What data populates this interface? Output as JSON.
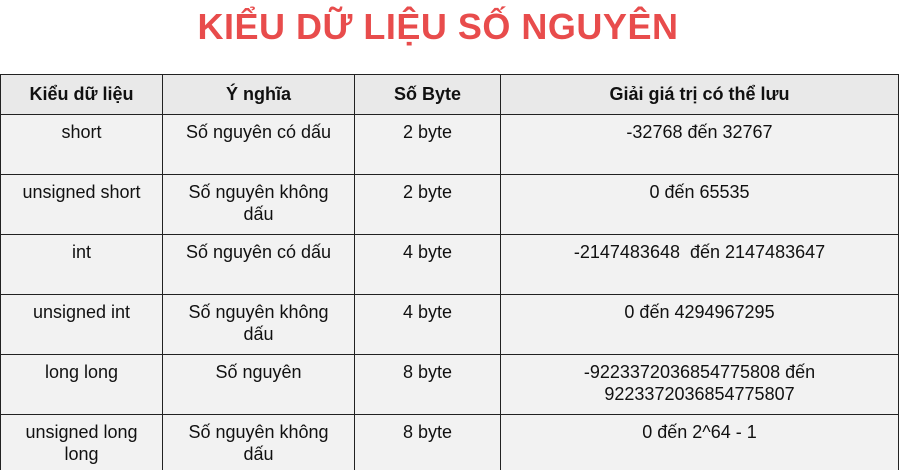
{
  "title": "KIỂU DỮ LIỆU SỐ NGUYÊN",
  "table": {
    "headers": [
      "Kiểu dữ liệu",
      "Ý nghĩa",
      "Số Byte",
      "Giải giá trị có thể lưu"
    ],
    "rows": [
      [
        "short",
        "Số nguyên có dấu",
        "2 byte",
        "-32768 đến 32767"
      ],
      [
        "unsigned short",
        "Số nguyên không dấu",
        "2 byte",
        "0 đến 65535"
      ],
      [
        "int",
        "Số nguyên có dấu",
        "4 byte",
        "-2147483648  đến 2147483647"
      ],
      [
        "unsigned int",
        "Số nguyên không dấu",
        "4 byte",
        "0 đến 4294967295"
      ],
      [
        "long long",
        "Số nguyên",
        "8 byte",
        "-9223372036854775808 đến 9223372036854775807"
      ],
      [
        "unsigned long long",
        "Số nguyên không dấu",
        "8 byte",
        "0 đến 2^64 - 1"
      ]
    ]
  },
  "colors": {
    "title": "#e84c4c",
    "header_bg": "#e9e9e9",
    "cell_bg": "#f2f2f2",
    "border": "#222222"
  }
}
